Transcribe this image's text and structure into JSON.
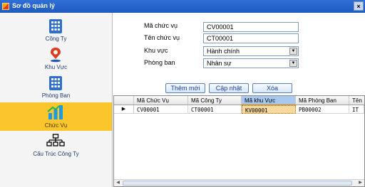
{
  "window": {
    "title": "Sơ đồ quản lý",
    "close_label": "×"
  },
  "sidebar": {
    "items": [
      {
        "label": "Công Ty",
        "icon": "building-grid-icon"
      },
      {
        "label": "Khu Vực",
        "icon": "map-pin-icon"
      },
      {
        "label": "Phòng Ban",
        "icon": "building-grid-icon"
      },
      {
        "label": "Chức Vụ",
        "icon": "bar-chart-icon"
      },
      {
        "label": "Cấu Trúc Công Ty",
        "icon": "org-chart-icon"
      }
    ],
    "active_index": 3,
    "accent": "#fbc62b"
  },
  "form": {
    "ma_chuc_vu_label": "Mã chức vụ",
    "ma_chuc_vu_value": "CV00001",
    "ten_chuc_vu_label": "Tên chức vụ",
    "ten_chuc_vu_value": "CT00001",
    "khu_vuc_label": "Khu vực",
    "khu_vuc_value": "Hành chính",
    "phong_ban_label": "Phòng ban",
    "phong_ban_value": "Nhân sự"
  },
  "buttons": {
    "add": "Thêm mới",
    "update": "Cập nhật",
    "delete": "Xóa"
  },
  "grid": {
    "columns": [
      "Mã Chức Vụ",
      "Mã Công Ty",
      "Mã khu Vực",
      "Mã Phòng Ban",
      "Tên"
    ],
    "rows": [
      [
        "CV00001",
        "CT00001",
        "KV00001",
        "PB00002",
        "IT"
      ]
    ],
    "row_marker": "▶",
    "selected_column": 2
  }
}
